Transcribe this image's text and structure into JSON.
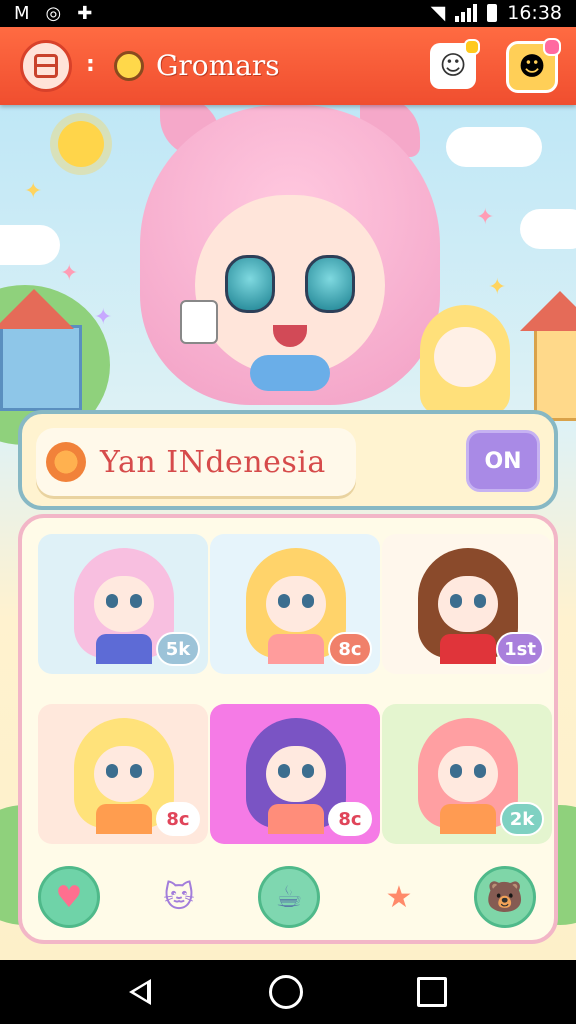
{
  "status_bar": {
    "time": "16:38"
  },
  "app_bar": {
    "title": "Gromars",
    "separator": ":"
  },
  "profile_banner": {
    "player_name": "Yan INdenesia",
    "toggle_label": "ON"
  },
  "characters": [
    {
      "name": "pink-hair-girl",
      "count": "5k",
      "bg": "#dff1f7",
      "hair": "#f8bfe0",
      "outfit": "#5d6bd6",
      "badge_color": "#9cc3d8"
    },
    {
      "name": "blonde-twintail-girl",
      "count": "8c",
      "bg": "#e6f4fb",
      "hair": "#ffd36a",
      "outfit": "#ff9c9c",
      "badge_color": "#f0806a"
    },
    {
      "name": "brown-hair-girl",
      "count": "1st",
      "bg": "#fff7ec",
      "hair": "#8a4a2b",
      "outfit": "#e0343a",
      "badge_color": "#a97fdc"
    },
    {
      "name": "yellow-hair-girl",
      "count": "8c",
      "bg": "#ffe8dc",
      "hair": "#ffe27a",
      "outfit": "#ff9d4f",
      "badge_color": "#ffffff"
    },
    {
      "name": "purple-hair-catgirl",
      "count": "8c",
      "bg": "#f57be6",
      "hair": "#7a54c4",
      "outfit": "#ff8d7a",
      "badge_color": "#ffffff"
    },
    {
      "name": "peach-hair-girl",
      "count": "2k",
      "bg": "#e4f5cf",
      "hair": "#ff9fa2",
      "outfit": "#ff9b52",
      "badge_color": "#7fd1c2"
    }
  ],
  "dock": [
    {
      "name": "heart-chat-icon",
      "glyph": "♥",
      "bg": "#6fd3a8",
      "color": "#ff6f8f"
    },
    {
      "name": "cat-mascot-icon",
      "glyph": "🐱",
      "bg": "transparent",
      "color": "#a27ddb"
    },
    {
      "name": "cup-icon",
      "glyph": "☕",
      "bg": "#7fd7b0",
      "color": "#5a7ea8"
    },
    {
      "name": "star-face-icon",
      "glyph": "★",
      "bg": "transparent",
      "color": "#ff8a6a"
    },
    {
      "name": "bear-face-icon",
      "glyph": "🐻",
      "bg": "#7fd6a8",
      "color": "#ff9fb1"
    }
  ],
  "colors": {
    "app_bar": "#f04e2f",
    "name_text": "#d64b4b",
    "toggle": "#a98ae6"
  }
}
